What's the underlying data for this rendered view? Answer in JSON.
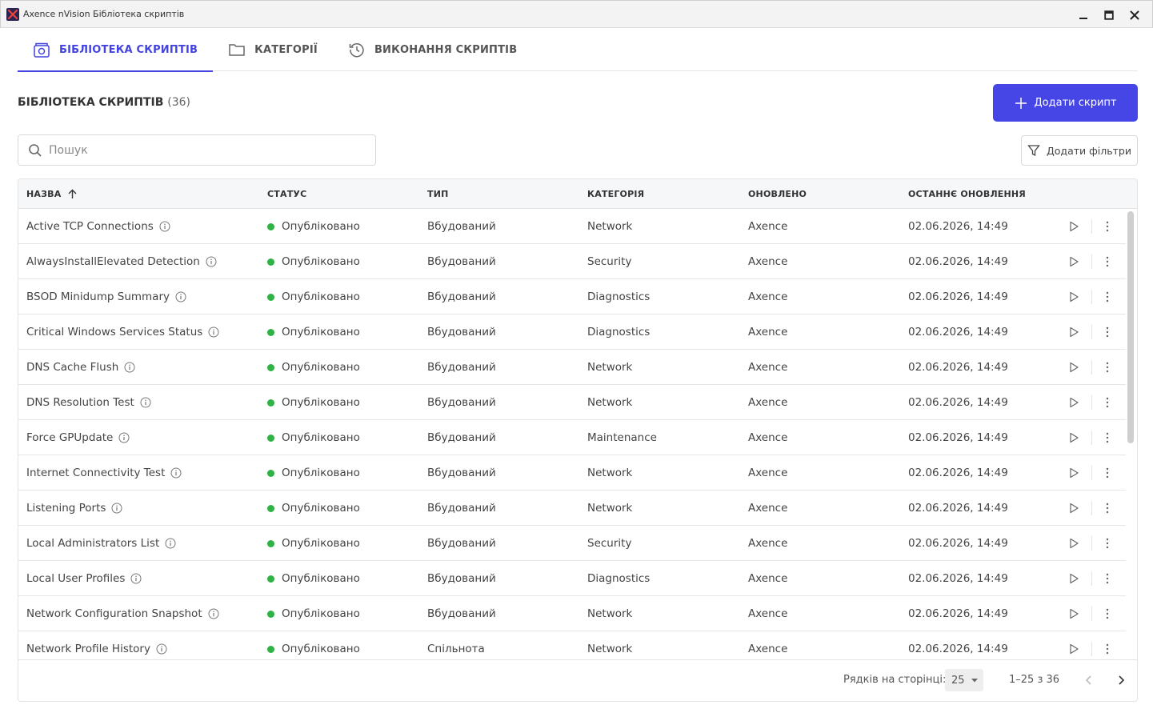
{
  "window": {
    "title": "Axence nVision Бібліотека скриптів"
  },
  "tabs": [
    {
      "label": "БІБЛІОТЕКА СКРИПТІВ",
      "icon": "script-library-icon",
      "active": true
    },
    {
      "label": "КАТЕГОРІЇ",
      "icon": "folder-icon",
      "active": false
    },
    {
      "label": "ВИКОНАННЯ СКРИПТІВ",
      "icon": "history-icon",
      "active": false
    }
  ],
  "header": {
    "title": "БІБЛІОТЕКА СКРИПТІВ",
    "count": "(36)",
    "add_label": "Додати скрипт"
  },
  "search": {
    "placeholder": "Пошук",
    "value": ""
  },
  "filters": {
    "label": "Додати фільтри"
  },
  "table": {
    "columns": [
      "НАЗВА",
      "СТАТУС",
      "ТИП",
      "КАТЕГОРІЯ",
      "ОНОВЛЕНО",
      "ОСТАННЄ ОНОВЛЕННЯ"
    ],
    "sort": {
      "column": "НАЗВА",
      "direction": "asc"
    },
    "status_color": "#2fb344",
    "rows": [
      {
        "name": "Active TCP Connections",
        "status": "Опубліковано",
        "type": "Вбудований",
        "category": "Network",
        "updated_by": "Axence",
        "last_update": "02.06.2026, 14:49"
      },
      {
        "name": "AlwaysInstallElevated Detection",
        "status": "Опубліковано",
        "type": "Вбудований",
        "category": "Security",
        "updated_by": "Axence",
        "last_update": "02.06.2026, 14:49"
      },
      {
        "name": "BSOD Minidump Summary",
        "status": "Опубліковано",
        "type": "Вбудований",
        "category": "Diagnostics",
        "updated_by": "Axence",
        "last_update": "02.06.2026, 14:49"
      },
      {
        "name": "Critical Windows Services Status",
        "status": "Опубліковано",
        "type": "Вбудований",
        "category": "Diagnostics",
        "updated_by": "Axence",
        "last_update": "02.06.2026, 14:49"
      },
      {
        "name": "DNS Cache Flush",
        "status": "Опубліковано",
        "type": "Вбудований",
        "category": "Network",
        "updated_by": "Axence",
        "last_update": "02.06.2026, 14:49"
      },
      {
        "name": "DNS Resolution Test",
        "status": "Опубліковано",
        "type": "Вбудований",
        "category": "Network",
        "updated_by": "Axence",
        "last_update": "02.06.2026, 14:49"
      },
      {
        "name": "Force GPUpdate",
        "status": "Опубліковано",
        "type": "Вбудований",
        "category": "Maintenance",
        "updated_by": "Axence",
        "last_update": "02.06.2026, 14:49"
      },
      {
        "name": "Internet Connectivity Test",
        "status": "Опубліковано",
        "type": "Вбудований",
        "category": "Network",
        "updated_by": "Axence",
        "last_update": "02.06.2026, 14:49"
      },
      {
        "name": "Listening Ports",
        "status": "Опубліковано",
        "type": "Вбудований",
        "category": "Network",
        "updated_by": "Axence",
        "last_update": "02.06.2026, 14:49"
      },
      {
        "name": "Local Administrators List",
        "status": "Опубліковано",
        "type": "Вбудований",
        "category": "Security",
        "updated_by": "Axence",
        "last_update": "02.06.2026, 14:49"
      },
      {
        "name": "Local User Profiles",
        "status": "Опубліковано",
        "type": "Вбудований",
        "category": "Diagnostics",
        "updated_by": "Axence",
        "last_update": "02.06.2026, 14:49"
      },
      {
        "name": "Network Configuration Snapshot",
        "status": "Опубліковано",
        "type": "Вбудований",
        "category": "Network",
        "updated_by": "Axence",
        "last_update": "02.06.2026, 14:49"
      },
      {
        "name": "Network Profile History",
        "status": "Опубліковано",
        "type": "Спільнота",
        "category": "Network",
        "updated_by": "Axence",
        "last_update": "02.06.2026, 14:49"
      }
    ]
  },
  "pagination": {
    "rows_per_page_label": "Рядків на сторінці:",
    "rows_per_page": "25",
    "range": "1–25 з 36"
  },
  "colors": {
    "accent": "#4646e6",
    "published": "#2fb344"
  }
}
